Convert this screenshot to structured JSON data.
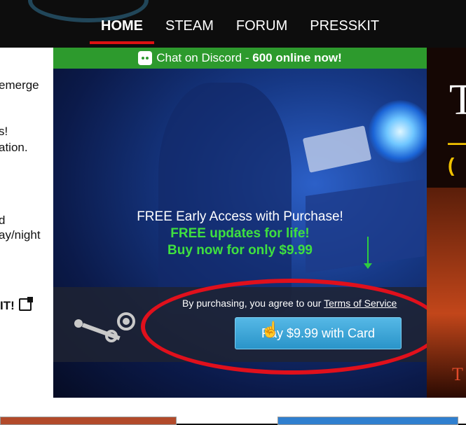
{
  "nav": {
    "items": [
      {
        "label": "HOME",
        "active": true
      },
      {
        "label": "STEAM",
        "active": false
      },
      {
        "label": "FORUM",
        "active": false
      },
      {
        "label": "PRESSKIT",
        "active": false
      }
    ]
  },
  "left_panel": {
    "fragments": [
      "emerge",
      "s!",
      "ation.",
      "d",
      "ay/night"
    ],
    "external_link": "IT!"
  },
  "discord": {
    "prefix": "Chat on Discord - ",
    "online": "600 online now!",
    "icon": "discord-icon"
  },
  "promo": {
    "line1": "FREE Early Access with Purchase!",
    "line2": "FREE updates for life!",
    "line3": "Buy now for only $9.99"
  },
  "purchase": {
    "tos_prefix": "By purchasing, you agree to our ",
    "tos_link": "Terms of Service",
    "button_label": "Pay $9.99 with Card"
  },
  "right_panel": {
    "big_letter": "T",
    "dash": "—(",
    "bottom_letter": "T"
  },
  "colors": {
    "discord_green": "#2d9a2d",
    "promo_green": "#3fe03f",
    "button_blue": "#2a94c9",
    "highlight_red": "#e0101c",
    "nav_active_underline": "#dd1111"
  }
}
